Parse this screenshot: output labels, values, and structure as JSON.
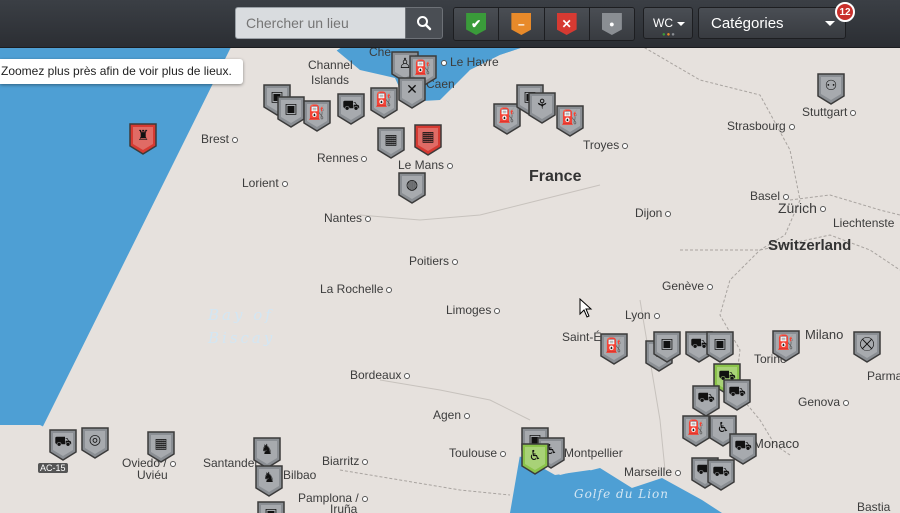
{
  "search": {
    "placeholder": "Chercher un lieu"
  },
  "filters": [
    {
      "name": "filter-open",
      "glyph": "✔",
      "color": "#3a9b3a"
    },
    {
      "name": "filter-partial",
      "glyph": "–",
      "color": "#e88a2a"
    },
    {
      "name": "filter-closed",
      "glyph": "✕",
      "color": "#d63a32"
    },
    {
      "name": "filter-unknown",
      "glyph": "●",
      "color": "#8a8e93"
    }
  ],
  "wc_filter": {
    "label": "WC"
  },
  "categories": {
    "label": "Catégories",
    "count": "12"
  },
  "zoom_message": "Zoomez plus près afin de voir plus de lieux.",
  "map": {
    "country_labels": [
      "France",
      "Switzerland"
    ],
    "sea_labels": [
      "Bay of",
      "Biscay",
      "Golfe du Lion"
    ],
    "places": [
      "Channel",
      "Islands",
      "Che",
      "Le Havre",
      "Caen",
      "Brest",
      "Rennes",
      "Le Mans",
      "Lorient",
      "Nantes",
      "Troyes",
      "Strasbourg",
      "Stuttgart",
      "Basel",
      "Zürich",
      "Liechtenste",
      "Dijon",
      "Poitiers",
      "La Rochelle",
      "Limoges",
      "Genève",
      "Lyon",
      "Saint-É",
      "Milano",
      "Torino",
      "Parma",
      "Bordeaux",
      "Genova",
      "Agen",
      "Toulouse",
      "Montpellier",
      "Marseille",
      "Monaco",
      "Bastia",
      "Biarritz",
      "Pamplona /",
      "Iruña",
      "Oviedo /",
      "Uviéu",
      "Santander",
      "Bilbao"
    ],
    "road": "AC-15"
  }
}
